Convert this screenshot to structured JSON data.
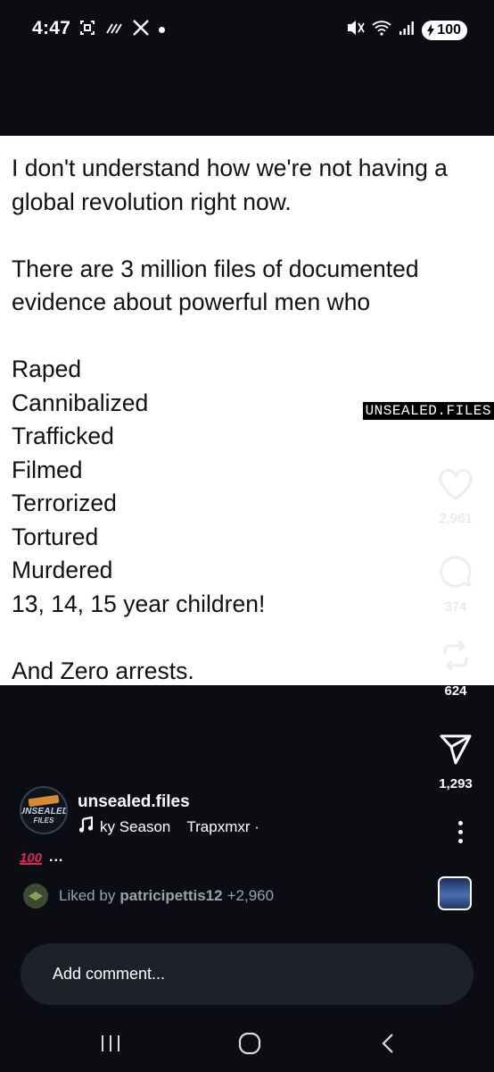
{
  "status_bar": {
    "time": "4:47",
    "battery": "100",
    "left_icons": [
      "screenshot-icon",
      "nfc-icon",
      "x-logo-icon",
      "notification-dot"
    ],
    "right_icons": [
      "mute-vibrate-icon",
      "wifi-icon",
      "signal-icon",
      "battery-icon"
    ]
  },
  "post": {
    "text": "I don't understand how we're not having a global revolution right now.\n\nThere are 3 million files of documented evidence about powerful men who\n\nRaped\nCannibalized\nTrafficked\nFilmed\nTerrorized\nTortured\nMurdered\n13, 14, 15 year children!\n\nAnd Zero arrests.",
    "watermark": "UNSEALED.FILES",
    "background_color": "#ffffff"
  },
  "actions": {
    "likes": "2,961",
    "comments": "374",
    "reposts": "624",
    "shares": "1,293"
  },
  "author": {
    "username": "unsealed.files",
    "avatar_lines": [
      "UNSEALED",
      "FILES"
    ],
    "audio_title": "ky Season",
    "audio_artist": "Trapxmxr ·"
  },
  "caption": {
    "emoji": "100",
    "more": "..."
  },
  "liked_by": {
    "prefix": "Liked by",
    "user": "patricipettis12",
    "rest": "+2,960"
  },
  "comment": {
    "placeholder": "Add comment..."
  },
  "colors": {
    "background": "#0b0d12",
    "post_background": "#ffffff",
    "comment_box": "#1f2128",
    "muted_text": "#9ca1ab",
    "emoji_red": "#e0245e"
  }
}
